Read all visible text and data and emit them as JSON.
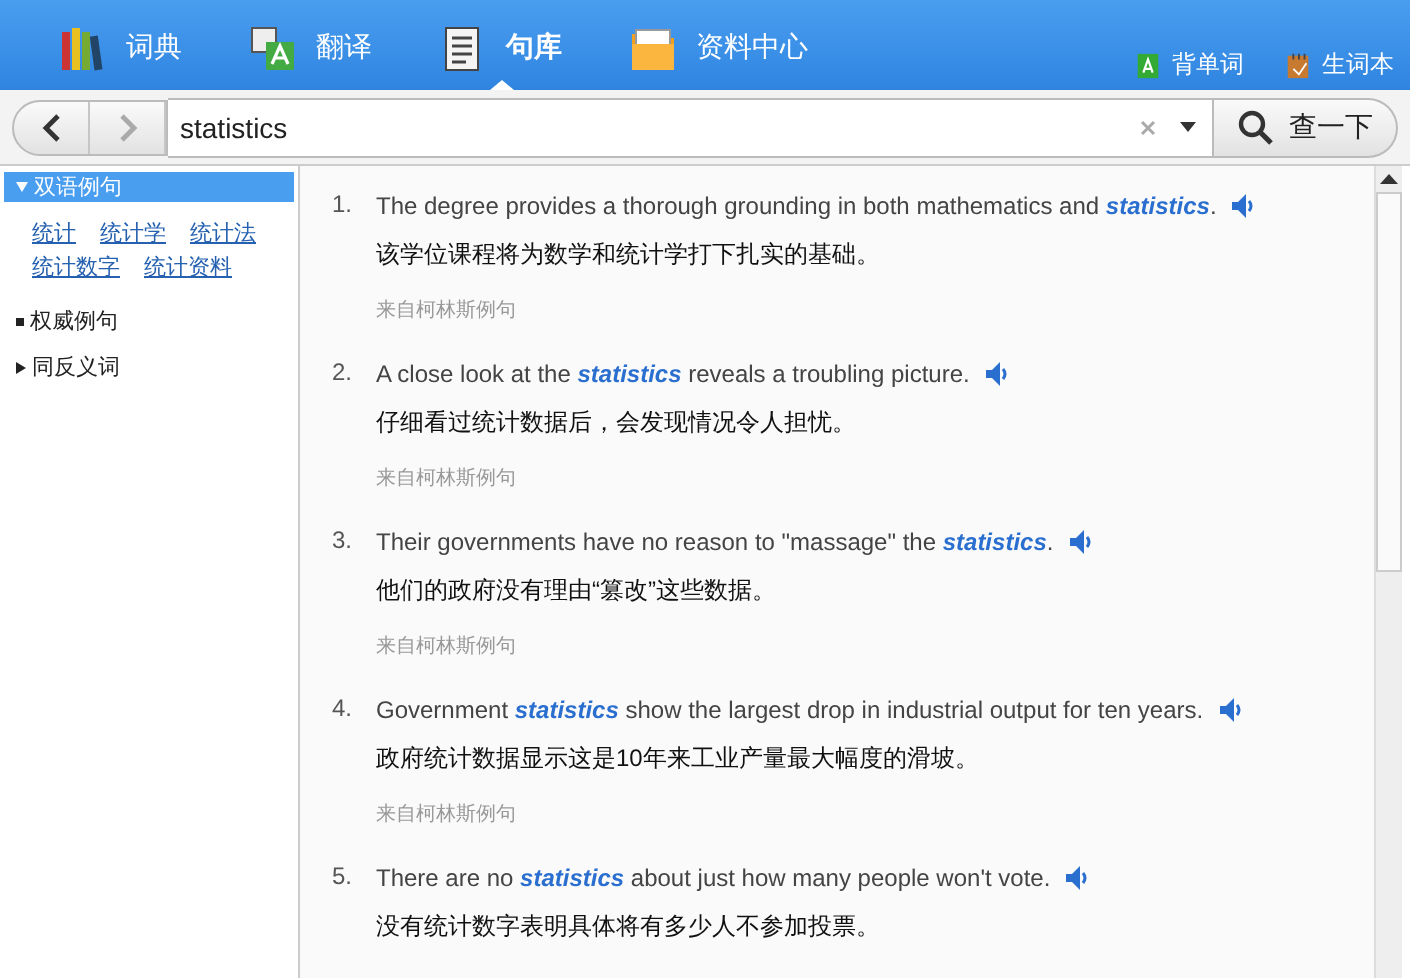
{
  "nav_tabs": [
    {
      "label": "词典",
      "selected": false
    },
    {
      "label": "翻译",
      "selected": false
    },
    {
      "label": "句库",
      "selected": true
    },
    {
      "label": "资料中心",
      "selected": false
    }
  ],
  "nav_links": [
    {
      "label": "背单词"
    },
    {
      "label": "生词本"
    }
  ],
  "search": {
    "value": "statistics",
    "button": "查一下"
  },
  "sidebar": {
    "sections": [
      {
        "label": "双语例句",
        "kind": "open",
        "selected": true,
        "links": [
          "统计",
          "统计学",
          "统计法",
          "统计数字",
          "统计资料"
        ]
      },
      {
        "label": "权威例句",
        "kind": "bullet",
        "selected": false
      },
      {
        "label": "同反义词",
        "kind": "closed",
        "selected": false
      }
    ]
  },
  "examples": [
    {
      "number": "1.",
      "sentence": "The degree provides a thorough grounding in both mathematics and **statistics**.",
      "translation": "该学位课程将为数学和统计学打下扎实的基础。",
      "source": "来自柯林斯例句"
    },
    {
      "number": "2.",
      "sentence": "A close look at the **statistics** reveals a troubling picture.",
      "translation": "仔细看过统计数据后，会发现情况令人担忧。",
      "source": "来自柯林斯例句"
    },
    {
      "number": "3.",
      "sentence": "Their governments have no reason to \"massage\" the **statistics**.",
      "translation": "他们的政府没有理由“篡改”这些数据。",
      "source": "来自柯林斯例句"
    },
    {
      "number": "4.",
      "sentence": "Government **statistics** show the largest drop in industrial output for ten years.",
      "translation": "政府统计数据显示这是10年来工业产量最大幅度的滑坡。",
      "source": "来自柯林斯例句"
    },
    {
      "number": "5.",
      "sentence": "There are no **statistics** about just how many people won't vote.",
      "translation": "没有统计数字表明具体将有多少人不参加投票。"
    }
  ]
}
